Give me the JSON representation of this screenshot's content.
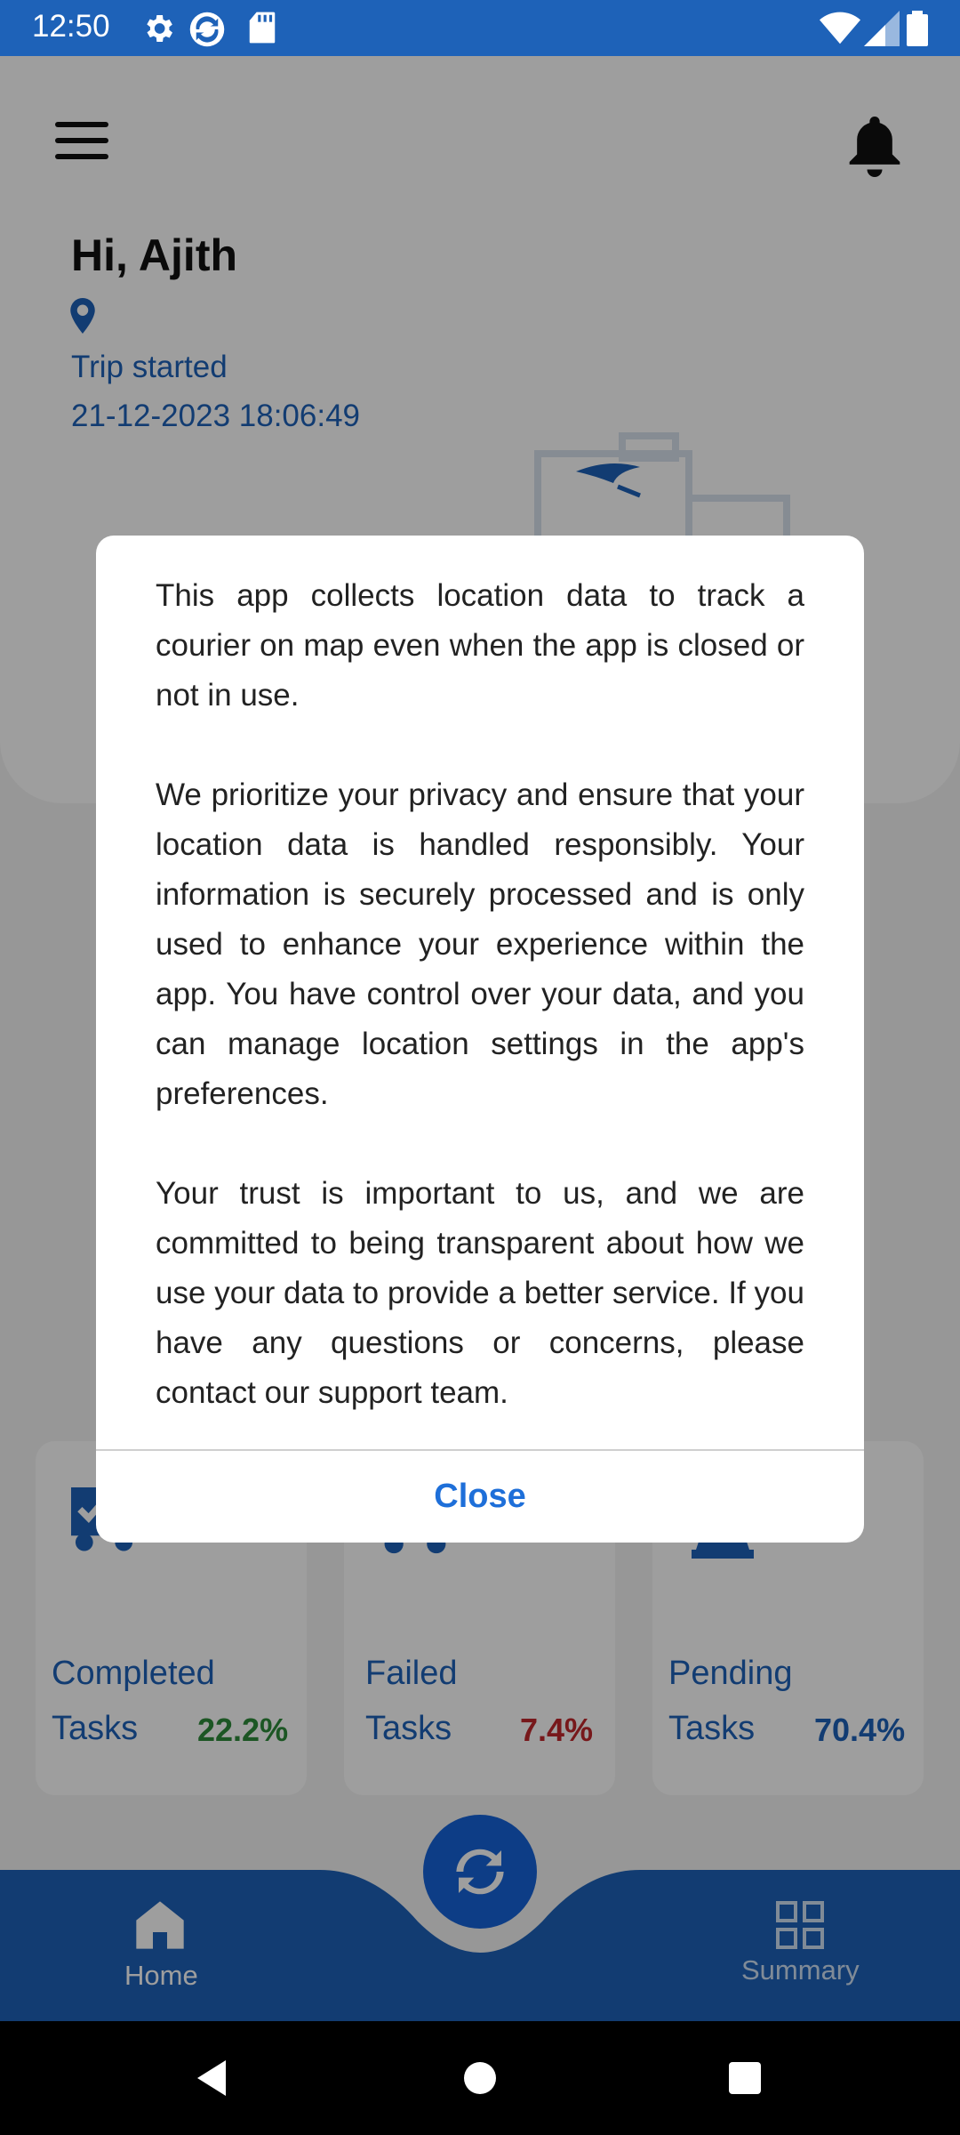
{
  "status_bar": {
    "time": "12:50"
  },
  "header": {
    "greeting": "Hi, Ajith",
    "trip_status": "Trip started",
    "trip_time": "21-12-2023 18:06:49"
  },
  "stats": [
    {
      "label_top": "Completed",
      "label_bottom": "Tasks",
      "percent": "22.2%",
      "color": "#2e8b3a"
    },
    {
      "label_top": "Failed",
      "label_bottom": "Tasks",
      "percent": "7.4%",
      "color": "#c0282d"
    },
    {
      "label_top": "Pending",
      "label_bottom": "Tasks",
      "percent": "70.4%",
      "color": "#1e62b8"
    }
  ],
  "bottom_nav": {
    "home_label": "Home",
    "summary_label": "Summary"
  },
  "dialog": {
    "paragraphs": [
      "This app collects location data to track a courier on map even when the app is closed or not in use.",
      "We prioritize your privacy and ensure that your location data is handled responsibly. Your information is securely processed and is only used to enhance your experience within the app. You have control over your data, and you can manage location settings in the app's preferences.",
      "Your trust is important to us, and we are committed to being transparent about how we use your data to provide a better service. If you have any questions or concerns, please contact our support team."
    ],
    "close_label": "Close"
  },
  "colors": {
    "primary": "#1e62b8",
    "accent": "#1e6fd9"
  }
}
